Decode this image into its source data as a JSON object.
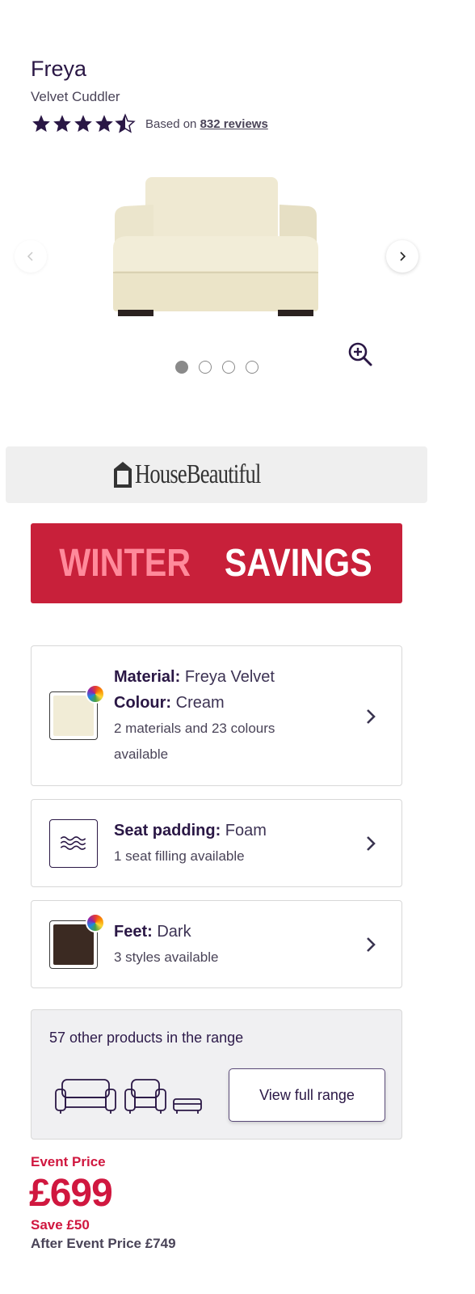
{
  "product": {
    "name": "Freya",
    "subtitle": "Velvet Cuddler",
    "rating": 4.5,
    "rating_max": 5,
    "based_on": "Based on",
    "reviews_link": "832 reviews"
  },
  "carousel": {
    "image": "sofa-cuddler-cream",
    "slide_count": 4,
    "active_slide": 1,
    "prev_icon": "chevron-left-icon",
    "next_icon": "chevron-right-icon",
    "zoom_icon": "zoom-in-icon"
  },
  "banners": {
    "house_beautiful": "HouseBeautiful",
    "winter_part1": "WINTER",
    "winter_part2": "SAVINGS"
  },
  "options": {
    "material": {
      "label": "Material:",
      "value": "Freya Velvet",
      "colour_label": "Colour:",
      "colour_value": "Cream",
      "availability_line1": "2 materials and 23 colours",
      "availability_line2": "available",
      "swatch_color": "#f1ecd6"
    },
    "seat": {
      "label": "Seat padding:",
      "value": "Foam",
      "availability": "1 seat filling available",
      "icon": "waves-icon"
    },
    "feet": {
      "label": "Feet:",
      "value": "Dark",
      "availability": "3 styles available",
      "swatch_color": "#3b2a22"
    }
  },
  "range": {
    "text": "57 other products in the range",
    "button": "View full range"
  },
  "pricing": {
    "event_label": "Event Price",
    "price": "£699",
    "save": "Save £50",
    "after_event": "After Event Price £749"
  },
  "colors": {
    "brand": "#2a1745",
    "accent_red": "#d0173f",
    "winter_bg": "#c8203a",
    "winter_pink": "#ff8a9b"
  }
}
